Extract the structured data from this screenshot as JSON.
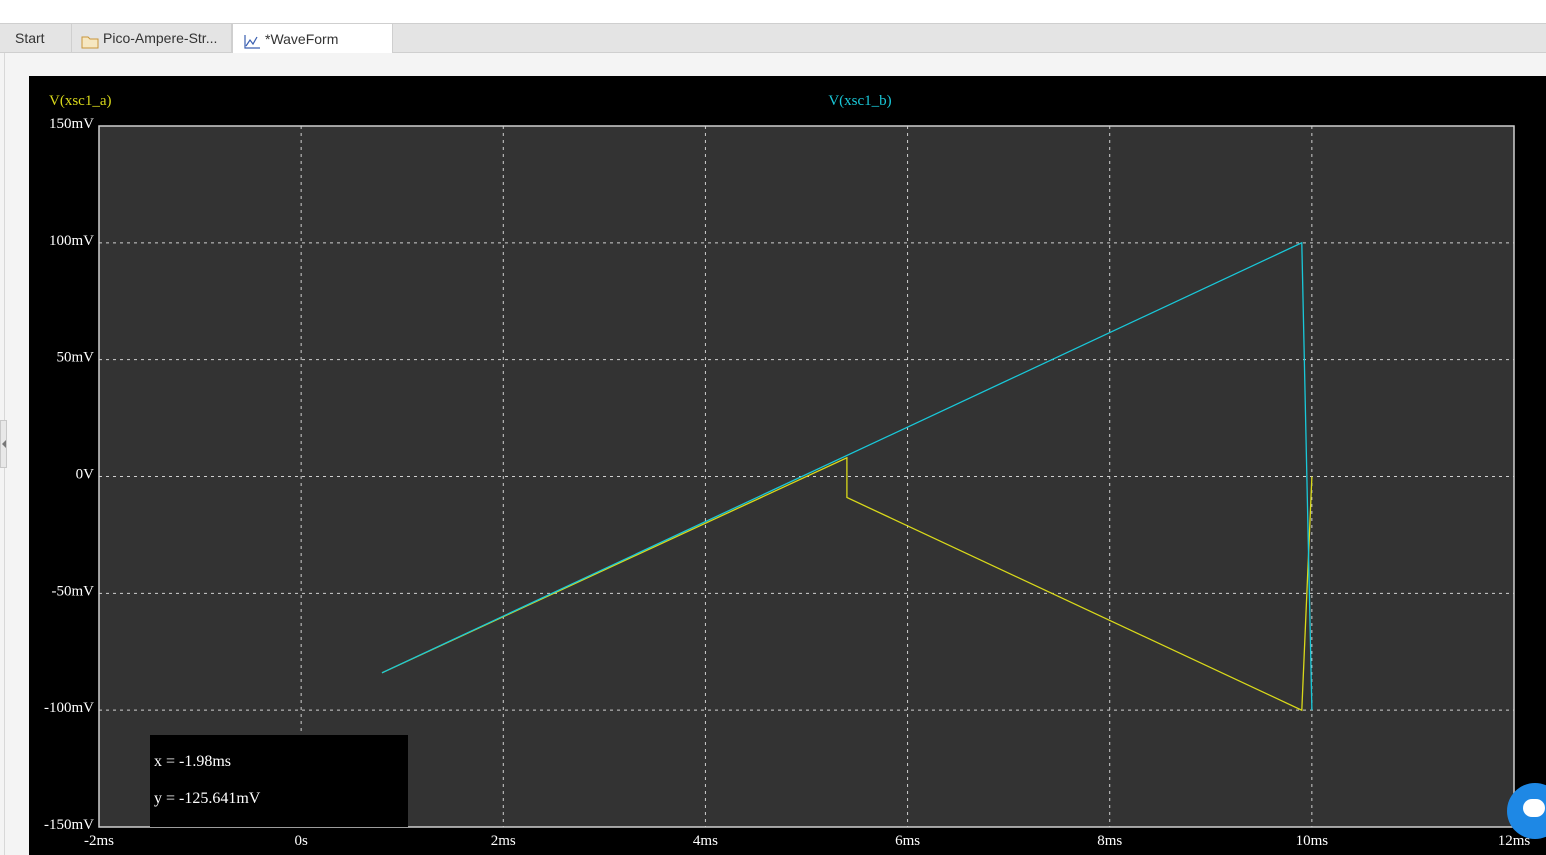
{
  "tabs": [
    {
      "label": "Start",
      "icon": "none"
    },
    {
      "label": "Pico-Ampere-Str...",
      "icon": "folder-icon"
    },
    {
      "label": "*WaveForm",
      "icon": "waveform-icon"
    }
  ],
  "cursor_readout": {
    "x": "x = -1.98ms",
    "y": "y = -125.641mV"
  },
  "colors": {
    "trace_a": "#d9d91a",
    "trace_b": "#19c8d9",
    "plot_bg": "#333333",
    "frame_bg": "#000000",
    "grid": "#d0d0d0"
  },
  "chart_data": {
    "type": "line",
    "title": "",
    "xlabel": "",
    "ylabel": "",
    "xlim": [
      -2,
      12
    ],
    "ylim": [
      -150,
      150
    ],
    "grid": true,
    "x_tick_values": [
      -2,
      0,
      2,
      4,
      6,
      8,
      10,
      12
    ],
    "x_tick_labels": [
      "-2ms",
      "0s",
      "2ms",
      "4ms",
      "6ms",
      "8ms",
      "10ms",
      "12ms"
    ],
    "y_tick_values": [
      150,
      100,
      50,
      0,
      -50,
      -100,
      -150
    ],
    "y_tick_labels": [
      "150mV",
      "100mV",
      "50mV",
      "0V",
      "-50mV",
      "-100mV",
      "-150mV"
    ],
    "series": [
      {
        "name": "V(xsc1_a)",
        "color": "#d9d91a",
        "legend": "top-left",
        "x": [
          0.8,
          5.4,
          5.4,
          9.9,
          10.0
        ],
        "y": [
          -84,
          8,
          -9,
          -100,
          0
        ]
      },
      {
        "name": "V(xsc1_b)",
        "color": "#19c8d9",
        "legend": "top-center",
        "x": [
          0.8,
          9.9,
          10.0,
          10.0
        ],
        "y": [
          -84,
          100,
          -100,
          -100
        ]
      }
    ]
  }
}
